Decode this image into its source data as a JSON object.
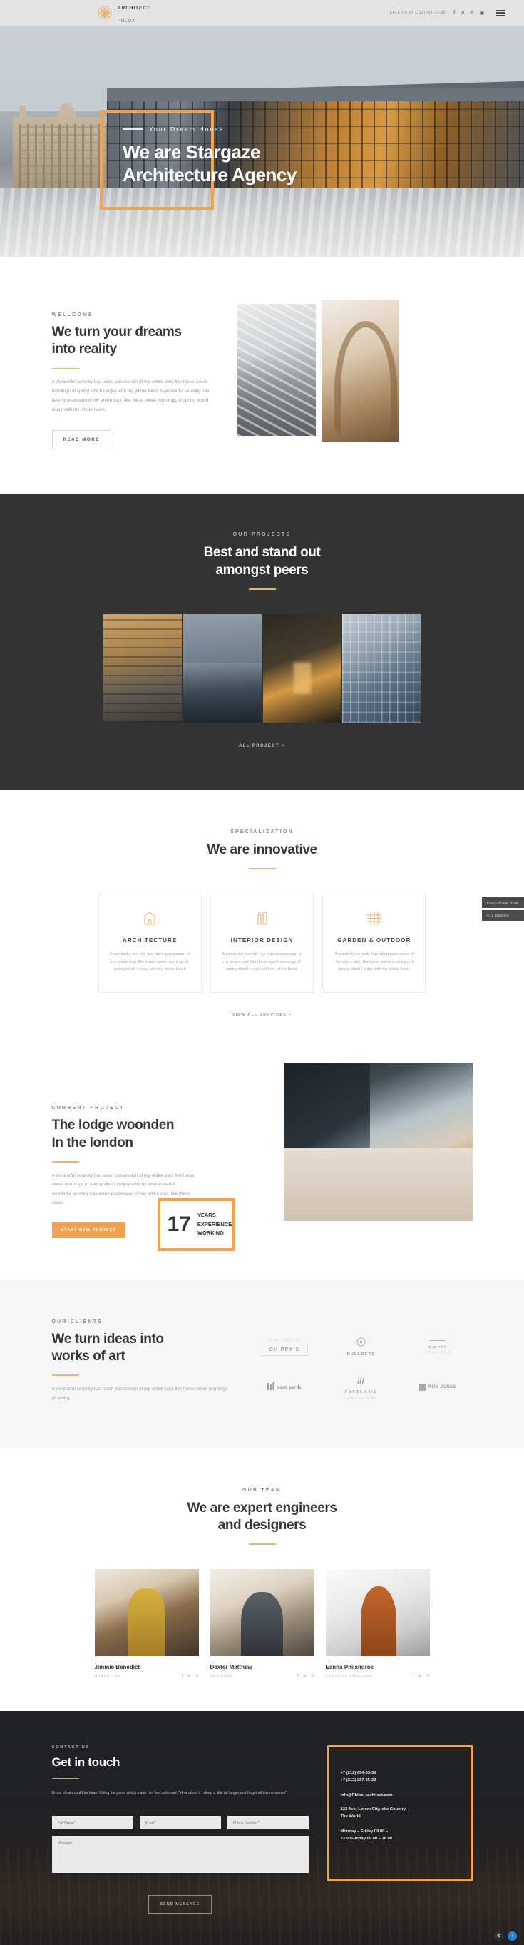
{
  "topbar": {
    "brand_name": "ARCHITECT",
    "brand_sub": "PHLOX",
    "call_us": "CALL US +7 (212)654-33-35",
    "socials": [
      "facebook-icon",
      "twitter-icon",
      "pinterest-icon",
      "instagram-icon"
    ],
    "menu": "hamburger-menu"
  },
  "hero": {
    "eyebrow": "Your Dream House",
    "title_line1": "We are Stargaze",
    "title_line2": "Architecture Agency"
  },
  "welcome": {
    "eyebrow": "WELLCOME",
    "title_line1": "We turn your dreams",
    "title_line2": "into reality",
    "body": "A wonderful serenity has taken possession of my entire soul, like these sweet mornings of spring which I enjoy with my whole heart.A wonderful serenity has taken possession of my entire soul, like these sweet mornings of spring which I enjoy with my whole heart.",
    "button": "READ MORE"
  },
  "projects": {
    "eyebrow": "OUR PROJECTS",
    "title_line1": "Best and stand out",
    "title_line2": "amongst peers",
    "all_link": "ALL PROJECT >",
    "items": [
      "project-balcony-building",
      "project-waterfront-house",
      "project-night-villa",
      "project-glass-office"
    ]
  },
  "specialization": {
    "eyebrow": "SPECIALIZATION",
    "title": "We are innovative",
    "see_all": "VIEW ALL SERVICES >",
    "cards": [
      {
        "icon": "house-icon",
        "title": "ARCHITECTURE",
        "body": "A wonderful serenity has taken possession of my entire soul, like these sweet mornings of spring which I enjoy with my whole heart."
      },
      {
        "icon": "pencil-ruler-icon",
        "title": "INTERIOR DESIGN",
        "body": "A wonderful serenity has taken possession of my entire soul, like these sweet mornings of spring which I enjoy with my whole heart."
      },
      {
        "icon": "grid-icon",
        "title": "GARDEN & OUTDOOR",
        "body": "A wonderful serenity has taken possession of my entire soul, like these sweet mornings of spring which I enjoy with my whole heart."
      }
    ]
  },
  "current_project": {
    "eyebrow": "CURRENT PROJECT",
    "title_line1": "The lodge woonden",
    "title_line2": "In the london",
    "body": "A wonderful serenity has taken possession of my entire soul, like these sweet mornings of spring which I enjoy with my whole heart.A wonderful serenity has taken possession of my entire soul, like these sweet",
    "button": "START NEW PROJECT",
    "badge_number": "17",
    "badge_line1": "YEARS",
    "badge_line2": "EXPERIENCE",
    "badge_line3": "WORKING"
  },
  "clients": {
    "eyebrow": "OUR CLIENTS",
    "title_line1": "We turn ideas into",
    "title_line2": "works of art",
    "body": "A wonderful serenity has taken possession of my entire soul, like these sweet mornings of spring.",
    "logos": [
      {
        "top": "ESTABLISHED 1976",
        "main": "CHIPPY'S",
        "sub": ""
      },
      {
        "top": "",
        "main": "BULLSEYE",
        "sub": ""
      },
      {
        "top": "",
        "main": "MIGHTY",
        "sub": "FURNITURES"
      },
      {
        "top": "",
        "main": "vant garde",
        "sub": ""
      },
      {
        "top": "",
        "main": "FASTLAME",
        "sub": "CONSTRUCTION"
      },
      {
        "top": "",
        "main": "RON JONES",
        "sub": ""
      }
    ]
  },
  "team": {
    "eyebrow": "OUR TEAM",
    "title_line1": "We are expert engineers",
    "title_line2": "and designers",
    "members": [
      {
        "name": "Jimmie Benedict",
        "role": "MARKETING",
        "socials": [
          "facebook-icon",
          "twitter-icon",
          "pinterest-icon"
        ]
      },
      {
        "name": "Dexter Matthew",
        "role": "DESIGNER",
        "socials": [
          "facebook-icon",
          "twitter-icon",
          "pinterest-icon"
        ]
      },
      {
        "name": "Eanna Philandros",
        "role": "CREATIVE DIRECTOR",
        "socials": [
          "facebook-icon",
          "twitter-icon",
          "pinterest-icon"
        ]
      }
    ]
  },
  "contact": {
    "eyebrow": "CONTACT US",
    "title": "Get in touch",
    "desc": "Drops of rain could be heard hitting the pane, which made him feel quite sad. \"How about if I sleep a little bit longer and forget all this nonsense\"",
    "fields": {
      "fullname_placeholder": "Full Name*",
      "email_placeholder": "Email*",
      "phone_placeholder": "Phone Number*",
      "message_placeholder": "Message"
    },
    "send_button": "SEND MESSAGE",
    "info": {
      "phone1": "+7 (212) 654-33-35",
      "phone2": "+7 (212) 287-85-22",
      "email": "info@Phlox_architect.com",
      "address_line1": "123 Ave, Lorem City, site Country,",
      "address_line2": "The World",
      "hours_line1": "Monday – Friday 09.00 –",
      "hours_line2": "23.00Sunday 09.00 – 16.00"
    }
  },
  "float_tabs": [
    "PURCHASE NOW",
    "ALL DEMOS"
  ],
  "fabs": [
    {
      "name": "settings-fab",
      "glyph": "⚙",
      "color": "#2f3336"
    },
    {
      "name": "scroll-top-fab",
      "glyph": "↑",
      "color": "#2f7fd6"
    }
  ]
}
